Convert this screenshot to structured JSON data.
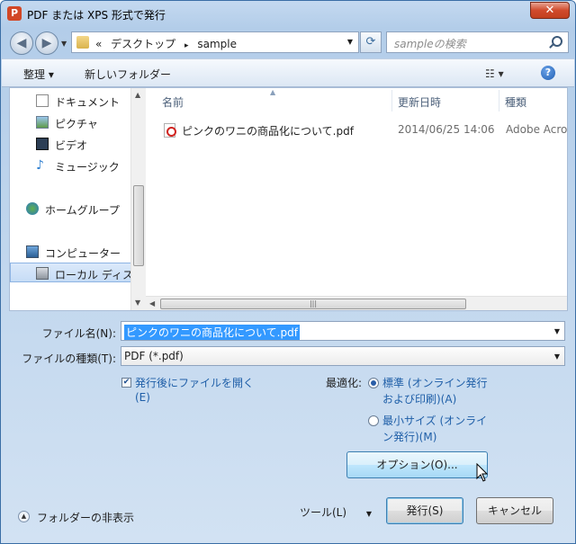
{
  "window": {
    "title": "PDF または XPS 形式で発行",
    "app_icon_letter": "P"
  },
  "address": {
    "prefix": "«",
    "crumbs": [
      "デスクトップ",
      "sample"
    ],
    "separator": "▸"
  },
  "search": {
    "placeholder": "sampleの検索"
  },
  "toolbar": {
    "organize": "整理 ▾",
    "new_folder": "新しいフォルダー"
  },
  "sidebar": {
    "items": [
      {
        "label": "ドキュメント",
        "icon": "document-icon"
      },
      {
        "label": "ピクチャ",
        "icon": "picture-icon"
      },
      {
        "label": "ビデオ",
        "icon": "video-icon"
      },
      {
        "label": "ミュージック",
        "icon": "music-icon"
      },
      {
        "label": "ホームグループ",
        "icon": "homegroup-icon"
      },
      {
        "label": "コンピューター",
        "icon": "computer-icon"
      },
      {
        "label": "ローカル ディスク",
        "icon": "disk-icon"
      }
    ]
  },
  "columns": {
    "name": "名前",
    "date": "更新日時",
    "type": "種類"
  },
  "files": [
    {
      "name": "ピンクのワニの商品化について.pdf",
      "date": "2014/06/25 14:06",
      "type": "Adobe Acrobat"
    }
  ],
  "form": {
    "filename_label": "ファイル名(N):",
    "filename_value": "ピンクのワニの商品化について.pdf",
    "filetype_label": "ファイルの種類(T):",
    "filetype_value": "PDF (*.pdf)",
    "open_after_line1": "発行後にファイルを開く",
    "open_after_line2": "(E)",
    "optimize_label": "最適化:",
    "opt_standard_line1": "標準 (オンライン発行",
    "opt_standard_line2": "および印刷)(A)",
    "opt_min_line1": "最小サイズ (オンライ",
    "opt_min_line2": "ン発行)(M)",
    "options_button": "オプション(O)..."
  },
  "footer": {
    "hide_folders": "フォルダーの非表示",
    "tools": "ツール(L)",
    "publish": "発行(S)",
    "cancel": "キャンセル"
  },
  "colors": {
    "accent": "#3399ff",
    "link": "#1f5fa8",
    "pdf_red": "#d0231f"
  }
}
